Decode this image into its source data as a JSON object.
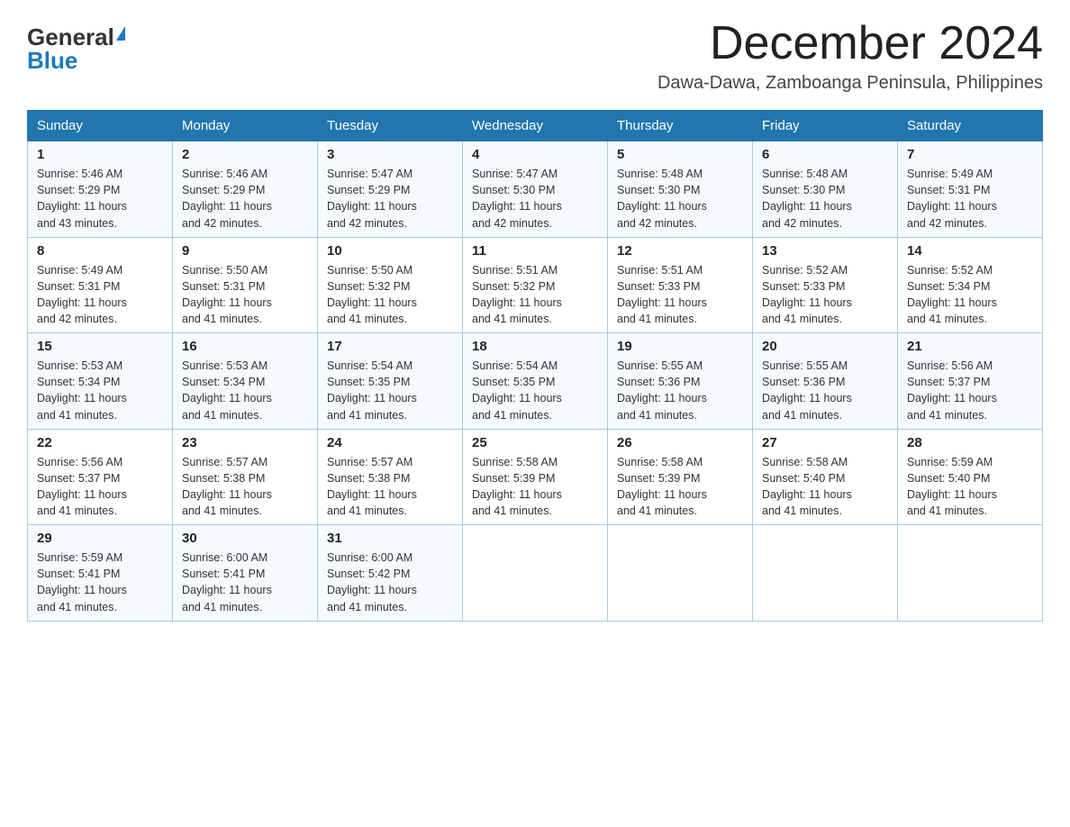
{
  "logo": {
    "general": "General",
    "blue": "Blue"
  },
  "title": "December 2024",
  "location": "Dawa-Dawa, Zamboanga Peninsula, Philippines",
  "headers": [
    "Sunday",
    "Monday",
    "Tuesday",
    "Wednesday",
    "Thursday",
    "Friday",
    "Saturday"
  ],
  "weeks": [
    [
      {
        "day": "1",
        "info": "Sunrise: 5:46 AM\nSunset: 5:29 PM\nDaylight: 11 hours\nand 43 minutes."
      },
      {
        "day": "2",
        "info": "Sunrise: 5:46 AM\nSunset: 5:29 PM\nDaylight: 11 hours\nand 42 minutes."
      },
      {
        "day": "3",
        "info": "Sunrise: 5:47 AM\nSunset: 5:29 PM\nDaylight: 11 hours\nand 42 minutes."
      },
      {
        "day": "4",
        "info": "Sunrise: 5:47 AM\nSunset: 5:30 PM\nDaylight: 11 hours\nand 42 minutes."
      },
      {
        "day": "5",
        "info": "Sunrise: 5:48 AM\nSunset: 5:30 PM\nDaylight: 11 hours\nand 42 minutes."
      },
      {
        "day": "6",
        "info": "Sunrise: 5:48 AM\nSunset: 5:30 PM\nDaylight: 11 hours\nand 42 minutes."
      },
      {
        "day": "7",
        "info": "Sunrise: 5:49 AM\nSunset: 5:31 PM\nDaylight: 11 hours\nand 42 minutes."
      }
    ],
    [
      {
        "day": "8",
        "info": "Sunrise: 5:49 AM\nSunset: 5:31 PM\nDaylight: 11 hours\nand 42 minutes."
      },
      {
        "day": "9",
        "info": "Sunrise: 5:50 AM\nSunset: 5:31 PM\nDaylight: 11 hours\nand 41 minutes."
      },
      {
        "day": "10",
        "info": "Sunrise: 5:50 AM\nSunset: 5:32 PM\nDaylight: 11 hours\nand 41 minutes."
      },
      {
        "day": "11",
        "info": "Sunrise: 5:51 AM\nSunset: 5:32 PM\nDaylight: 11 hours\nand 41 minutes."
      },
      {
        "day": "12",
        "info": "Sunrise: 5:51 AM\nSunset: 5:33 PM\nDaylight: 11 hours\nand 41 minutes."
      },
      {
        "day": "13",
        "info": "Sunrise: 5:52 AM\nSunset: 5:33 PM\nDaylight: 11 hours\nand 41 minutes."
      },
      {
        "day": "14",
        "info": "Sunrise: 5:52 AM\nSunset: 5:34 PM\nDaylight: 11 hours\nand 41 minutes."
      }
    ],
    [
      {
        "day": "15",
        "info": "Sunrise: 5:53 AM\nSunset: 5:34 PM\nDaylight: 11 hours\nand 41 minutes."
      },
      {
        "day": "16",
        "info": "Sunrise: 5:53 AM\nSunset: 5:34 PM\nDaylight: 11 hours\nand 41 minutes."
      },
      {
        "day": "17",
        "info": "Sunrise: 5:54 AM\nSunset: 5:35 PM\nDaylight: 11 hours\nand 41 minutes."
      },
      {
        "day": "18",
        "info": "Sunrise: 5:54 AM\nSunset: 5:35 PM\nDaylight: 11 hours\nand 41 minutes."
      },
      {
        "day": "19",
        "info": "Sunrise: 5:55 AM\nSunset: 5:36 PM\nDaylight: 11 hours\nand 41 minutes."
      },
      {
        "day": "20",
        "info": "Sunrise: 5:55 AM\nSunset: 5:36 PM\nDaylight: 11 hours\nand 41 minutes."
      },
      {
        "day": "21",
        "info": "Sunrise: 5:56 AM\nSunset: 5:37 PM\nDaylight: 11 hours\nand 41 minutes."
      }
    ],
    [
      {
        "day": "22",
        "info": "Sunrise: 5:56 AM\nSunset: 5:37 PM\nDaylight: 11 hours\nand 41 minutes."
      },
      {
        "day": "23",
        "info": "Sunrise: 5:57 AM\nSunset: 5:38 PM\nDaylight: 11 hours\nand 41 minutes."
      },
      {
        "day": "24",
        "info": "Sunrise: 5:57 AM\nSunset: 5:38 PM\nDaylight: 11 hours\nand 41 minutes."
      },
      {
        "day": "25",
        "info": "Sunrise: 5:58 AM\nSunset: 5:39 PM\nDaylight: 11 hours\nand 41 minutes."
      },
      {
        "day": "26",
        "info": "Sunrise: 5:58 AM\nSunset: 5:39 PM\nDaylight: 11 hours\nand 41 minutes."
      },
      {
        "day": "27",
        "info": "Sunrise: 5:58 AM\nSunset: 5:40 PM\nDaylight: 11 hours\nand 41 minutes."
      },
      {
        "day": "28",
        "info": "Sunrise: 5:59 AM\nSunset: 5:40 PM\nDaylight: 11 hours\nand 41 minutes."
      }
    ],
    [
      {
        "day": "29",
        "info": "Sunrise: 5:59 AM\nSunset: 5:41 PM\nDaylight: 11 hours\nand 41 minutes."
      },
      {
        "day": "30",
        "info": "Sunrise: 6:00 AM\nSunset: 5:41 PM\nDaylight: 11 hours\nand 41 minutes."
      },
      {
        "day": "31",
        "info": "Sunrise: 6:00 AM\nSunset: 5:42 PM\nDaylight: 11 hours\nand 41 minutes."
      },
      null,
      null,
      null,
      null
    ]
  ]
}
